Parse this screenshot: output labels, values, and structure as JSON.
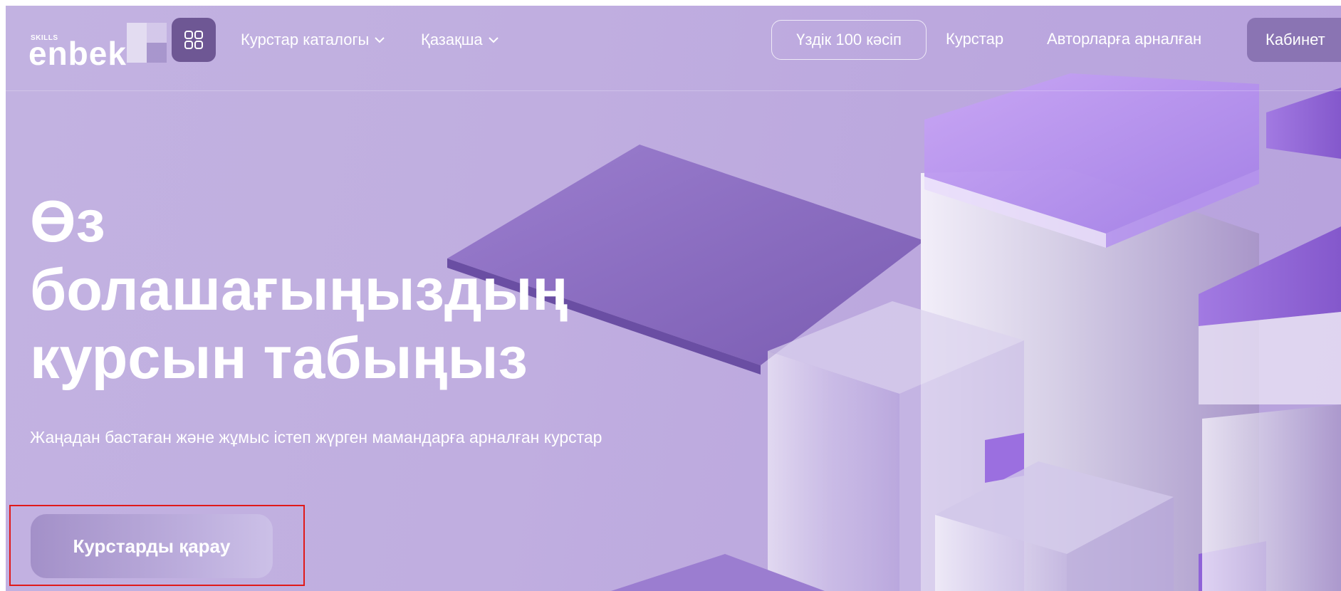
{
  "header": {
    "logo": {
      "small": "SKILLS",
      "main": "enbek"
    },
    "nav": {
      "catalog_label": "Курстар каталогы",
      "language_label": "Қазақша",
      "top100_label": "Үздік 100 кәсіп",
      "courses_label": "Курстар",
      "authors_label": "Авторларға арналған",
      "cabinet_label": "Кабинет"
    }
  },
  "hero": {
    "title_lines": [
      "Өз",
      "болашағыңыздың",
      "курсын табыңыз"
    ],
    "subtitle": "Жаңадан бастаған және жұмыс істеп жүрген мамандарға арналған курстар",
    "cta_label": "Курстарды қарау"
  },
  "colors": {
    "background": "#c0aee0",
    "apps_button": "#6e5794",
    "cabinet_button": "#8a74b3",
    "accent_purple": "#9a6fd6",
    "highlight": "#e01a1a"
  },
  "icons": [
    "apps-grid-icon",
    "chevron-down-icon"
  ]
}
